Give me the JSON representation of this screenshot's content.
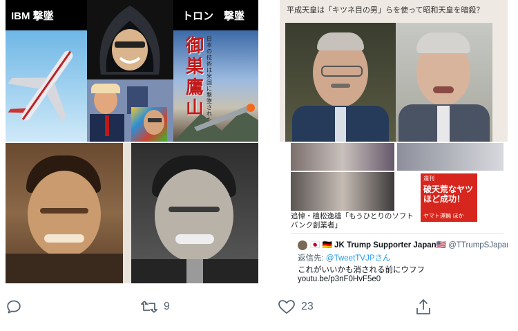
{
  "top_left": {
    "label_left": "IBM 撃墜",
    "label_right": "トロン　撃墜",
    "book_title": "御巣鷹山",
    "book_subtitle": "日本の技術は米国に撃墜された"
  },
  "top_right": {
    "caption": "平成天皇は「キツネ目の男」らを使って昭和天皇を暗殺？"
  },
  "bottom_right": {
    "article_caption": "追悼・植松逸雄「もうひとりのソフトバンク創業者」",
    "red_box_top": "週刊",
    "red_box_text": "破天荒なヤツほど成功！",
    "red_box_lower": "ヤマト運輸 ほか",
    "quote": {
      "flags": "🇯🇵 🇩🇪",
      "name": "JK Trump Supporter Japan",
      "handle": "@TTrumpSJapan",
      "reply_prefix": "返信先:",
      "reply_to": "@TweetTVJPさん",
      "text": "これがいいかも消される前にウフフ",
      "link": "youtu.be/p3nF0HvF5e0"
    }
  },
  "actions": {
    "reply_icon": "reply-icon",
    "retweet_icon": "retweet-icon",
    "retweet_count": "9",
    "like_icon": "heart-icon",
    "like_count": "23",
    "share_icon": "share-icon"
  },
  "colors": {
    "action_gray": "#536471",
    "link_blue": "#1d9bf0",
    "red_box": "#d7261e"
  }
}
